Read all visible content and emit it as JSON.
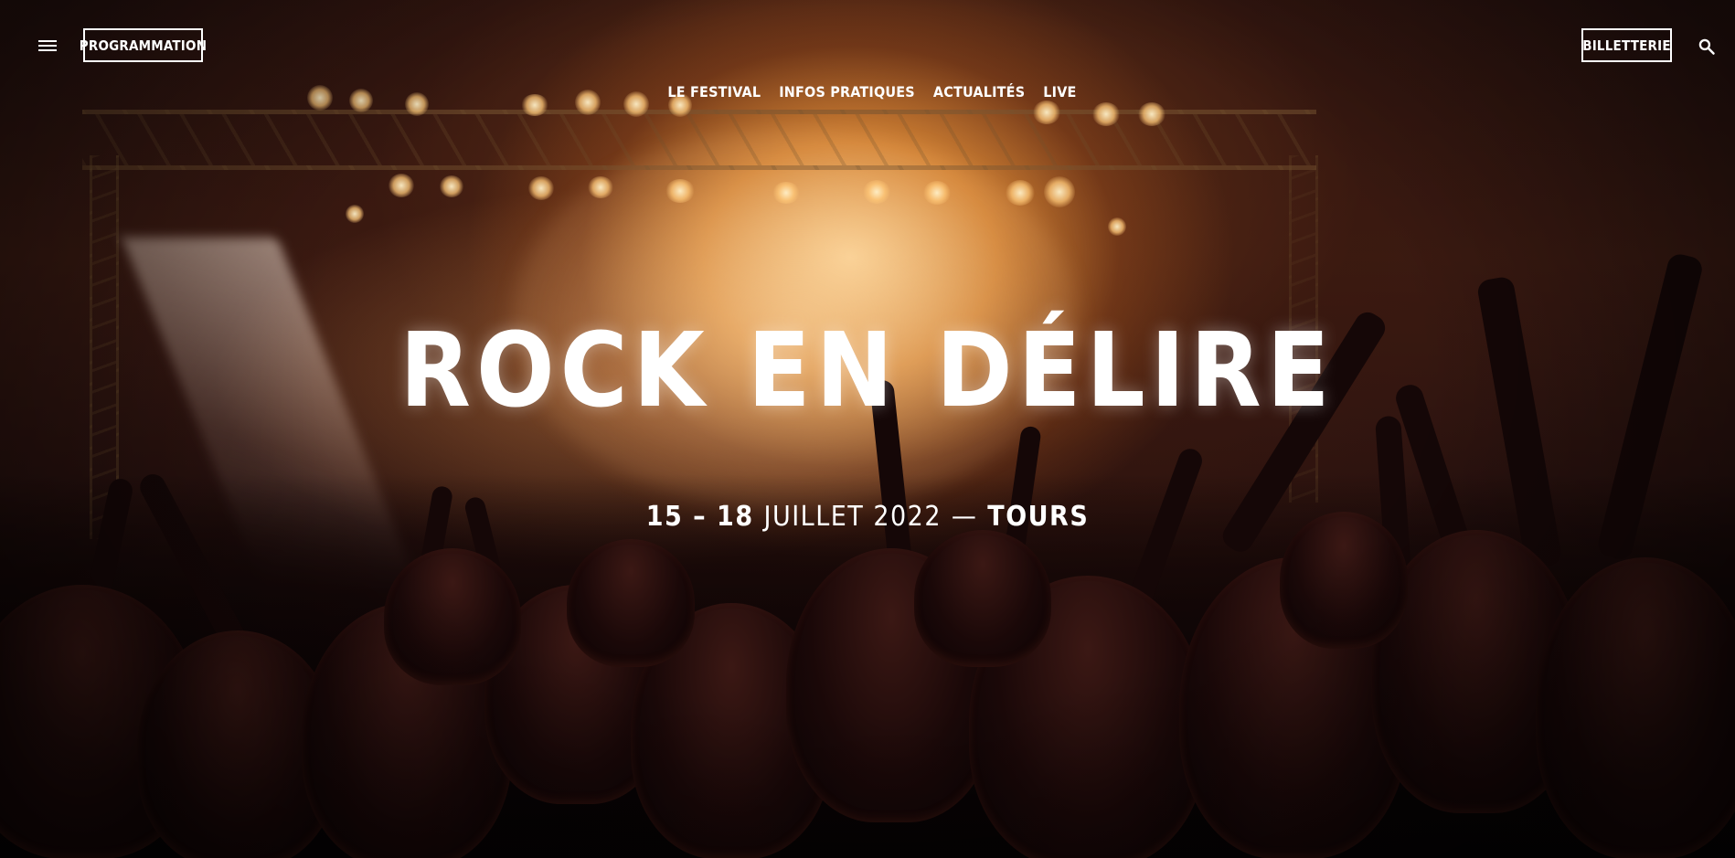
{
  "header": {
    "menu_icon": "hamburger-menu-icon",
    "programmation_label": "PROGRAMMATION",
    "billetterie_label": "BILLETTERIE",
    "search_icon": "search-icon"
  },
  "nav": {
    "items": [
      {
        "label": "LE FESTIVAL"
      },
      {
        "label": "INFOS PRATIQUES"
      },
      {
        "label": "ACTUALITÉS"
      },
      {
        "label": "LIVE"
      }
    ]
  },
  "hero": {
    "title": "ROCK EN DÉLIRE",
    "subtitle": {
      "dates": "15 – 18",
      "month_year": "JUILLET 2022",
      "separator": "—",
      "city": "TOURS"
    },
    "background": "concert crowd with stage lights (photo)"
  },
  "colors": {
    "text": "#ffffff",
    "stage_light": "#f5b060",
    "background_dark": "#1a0a0a"
  }
}
